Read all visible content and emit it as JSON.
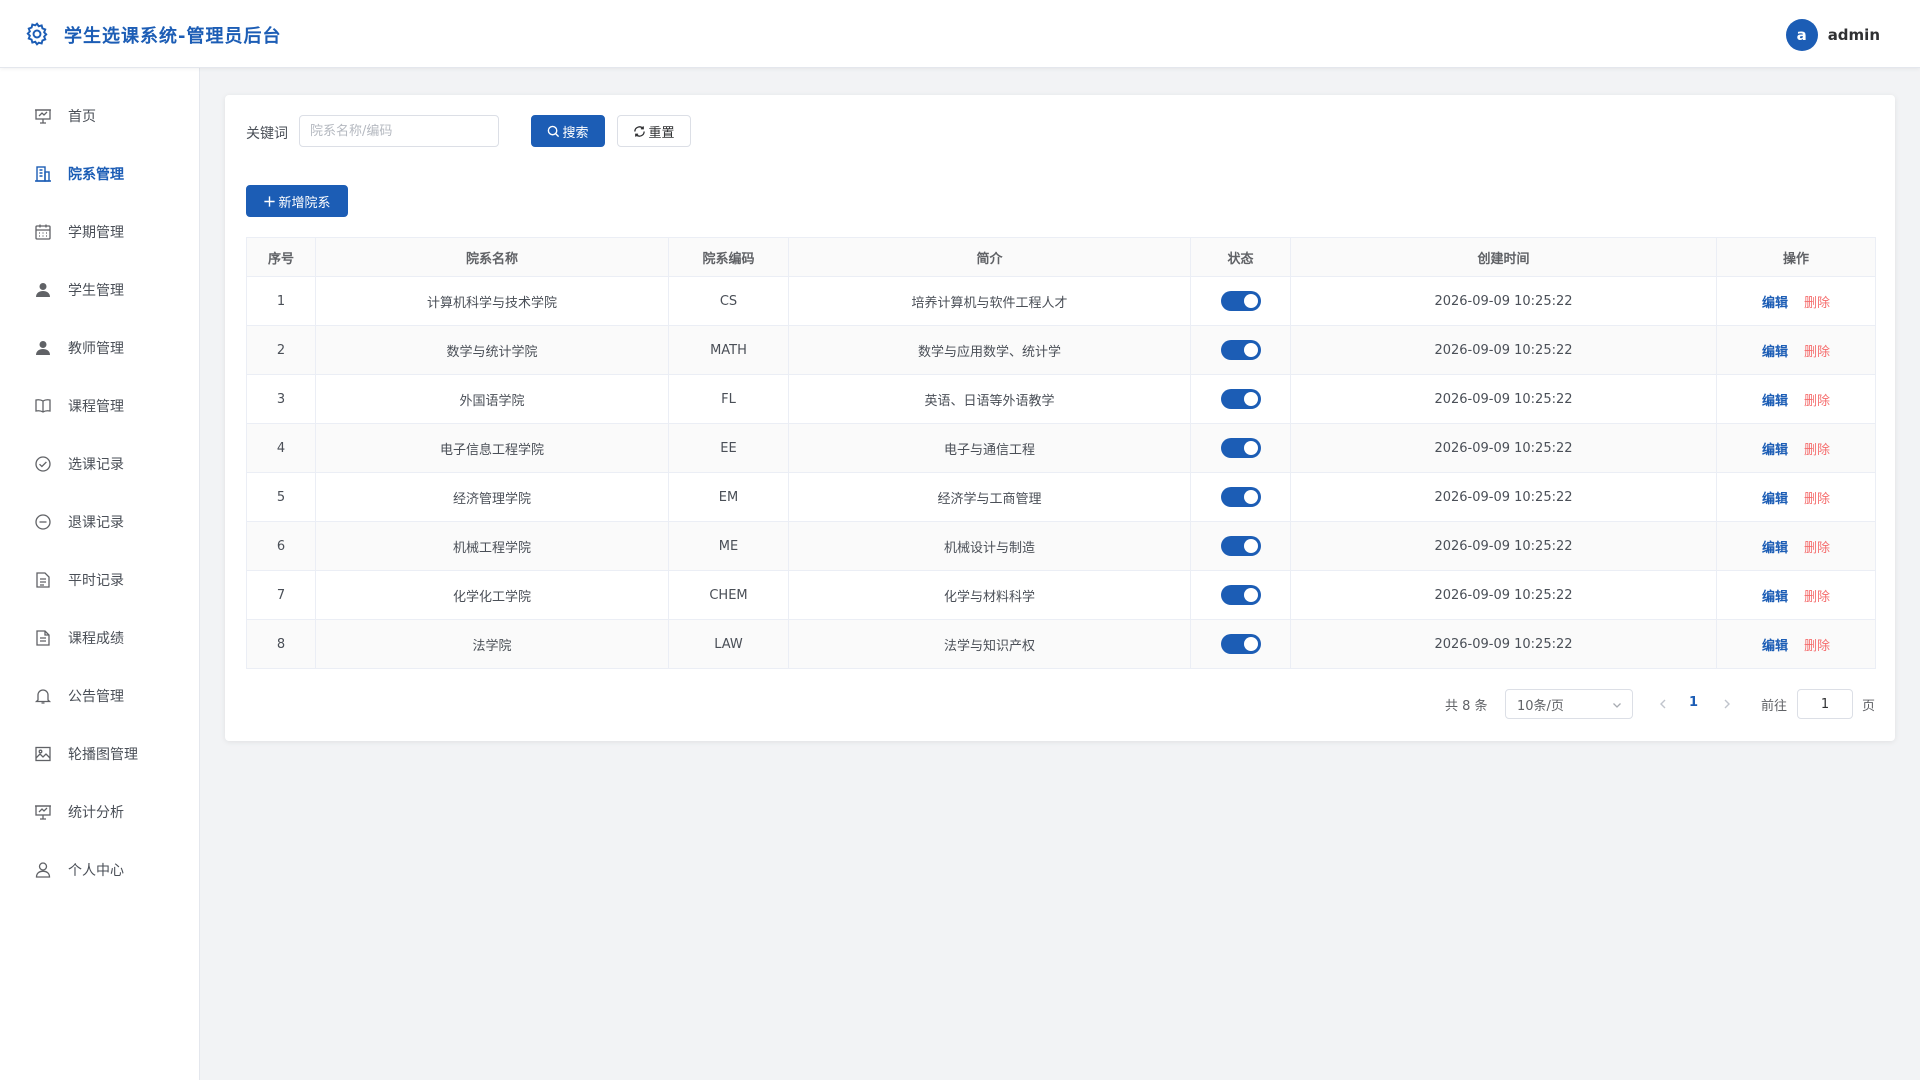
{
  "app": {
    "title": "学生选课系统-管理员后台",
    "logo_icon": "gear-icon"
  },
  "user": {
    "avatar_letter": "a",
    "name": "admin"
  },
  "colors": {
    "primary": "#1c5db5",
    "danger": "#f56c6c",
    "background": "#f2f3f5"
  },
  "sidebar": {
    "items": [
      {
        "label": "首页",
        "icon": "presentation-chart-icon"
      },
      {
        "label": "院系管理",
        "icon": "building-icon",
        "active": true
      },
      {
        "label": "学期管理",
        "icon": "calendar-icon"
      },
      {
        "label": "学生管理",
        "icon": "user-filled-icon"
      },
      {
        "label": "教师管理",
        "icon": "user-filled-icon"
      },
      {
        "label": "课程管理",
        "icon": "book-icon"
      },
      {
        "label": "选课记录",
        "icon": "check-circle-icon"
      },
      {
        "label": "退课记录",
        "icon": "minus-circle-icon"
      },
      {
        "label": "平时记录",
        "icon": "document-icon"
      },
      {
        "label": "课程成绩",
        "icon": "document-icon"
      },
      {
        "label": "公告管理",
        "icon": "bell-icon"
      },
      {
        "label": "轮播图管理",
        "icon": "picture-icon"
      },
      {
        "label": "统计分析",
        "icon": "presentation-chart-icon"
      },
      {
        "label": "个人中心",
        "icon": "user-outline-icon"
      }
    ]
  },
  "search": {
    "label": "关键词",
    "placeholder": "院系名称/编码",
    "value": "",
    "search_button": "搜索",
    "reset_button": "重置"
  },
  "add_button": "新增院系",
  "table": {
    "columns": [
      "序号",
      "院系名称",
      "院系编码",
      "简介",
      "状态",
      "创建时间",
      "操作"
    ],
    "rows": [
      {
        "index": "1",
        "name": "计算机科学与技术学院",
        "code": "CS",
        "desc": "培养计算机与软件工程人才",
        "status": true,
        "created": "2026-09-09 10:25:22"
      },
      {
        "index": "2",
        "name": "数学与统计学院",
        "code": "MATH",
        "desc": "数学与应用数学、统计学",
        "status": true,
        "created": "2026-09-09 10:25:22"
      },
      {
        "index": "3",
        "name": "外国语学院",
        "code": "FL",
        "desc": "英语、日语等外语教学",
        "status": true,
        "created": "2026-09-09 10:25:22"
      },
      {
        "index": "4",
        "name": "电子信息工程学院",
        "code": "EE",
        "desc": "电子与通信工程",
        "status": true,
        "created": "2026-09-09 10:25:22"
      },
      {
        "index": "5",
        "name": "经济管理学院",
        "code": "EM",
        "desc": "经济学与工商管理",
        "status": true,
        "created": "2026-09-09 10:25:22"
      },
      {
        "index": "6",
        "name": "机械工程学院",
        "code": "ME",
        "desc": "机械设计与制造",
        "status": true,
        "created": "2026-09-09 10:25:22"
      },
      {
        "index": "7",
        "name": "化学化工学院",
        "code": "CHEM",
        "desc": "化学与材料科学",
        "status": true,
        "created": "2026-09-09 10:25:22"
      },
      {
        "index": "8",
        "name": "法学院",
        "code": "LAW",
        "desc": "法学与知识产权",
        "status": true,
        "created": "2026-09-09 10:25:22"
      }
    ],
    "edit_label": "编辑",
    "delete_label": "删除"
  },
  "pagination": {
    "total": "共 8 条",
    "page_size": "10条/页",
    "current_page": "1",
    "goto_label": "前往",
    "goto_value": "1",
    "page_suffix": "页"
  }
}
